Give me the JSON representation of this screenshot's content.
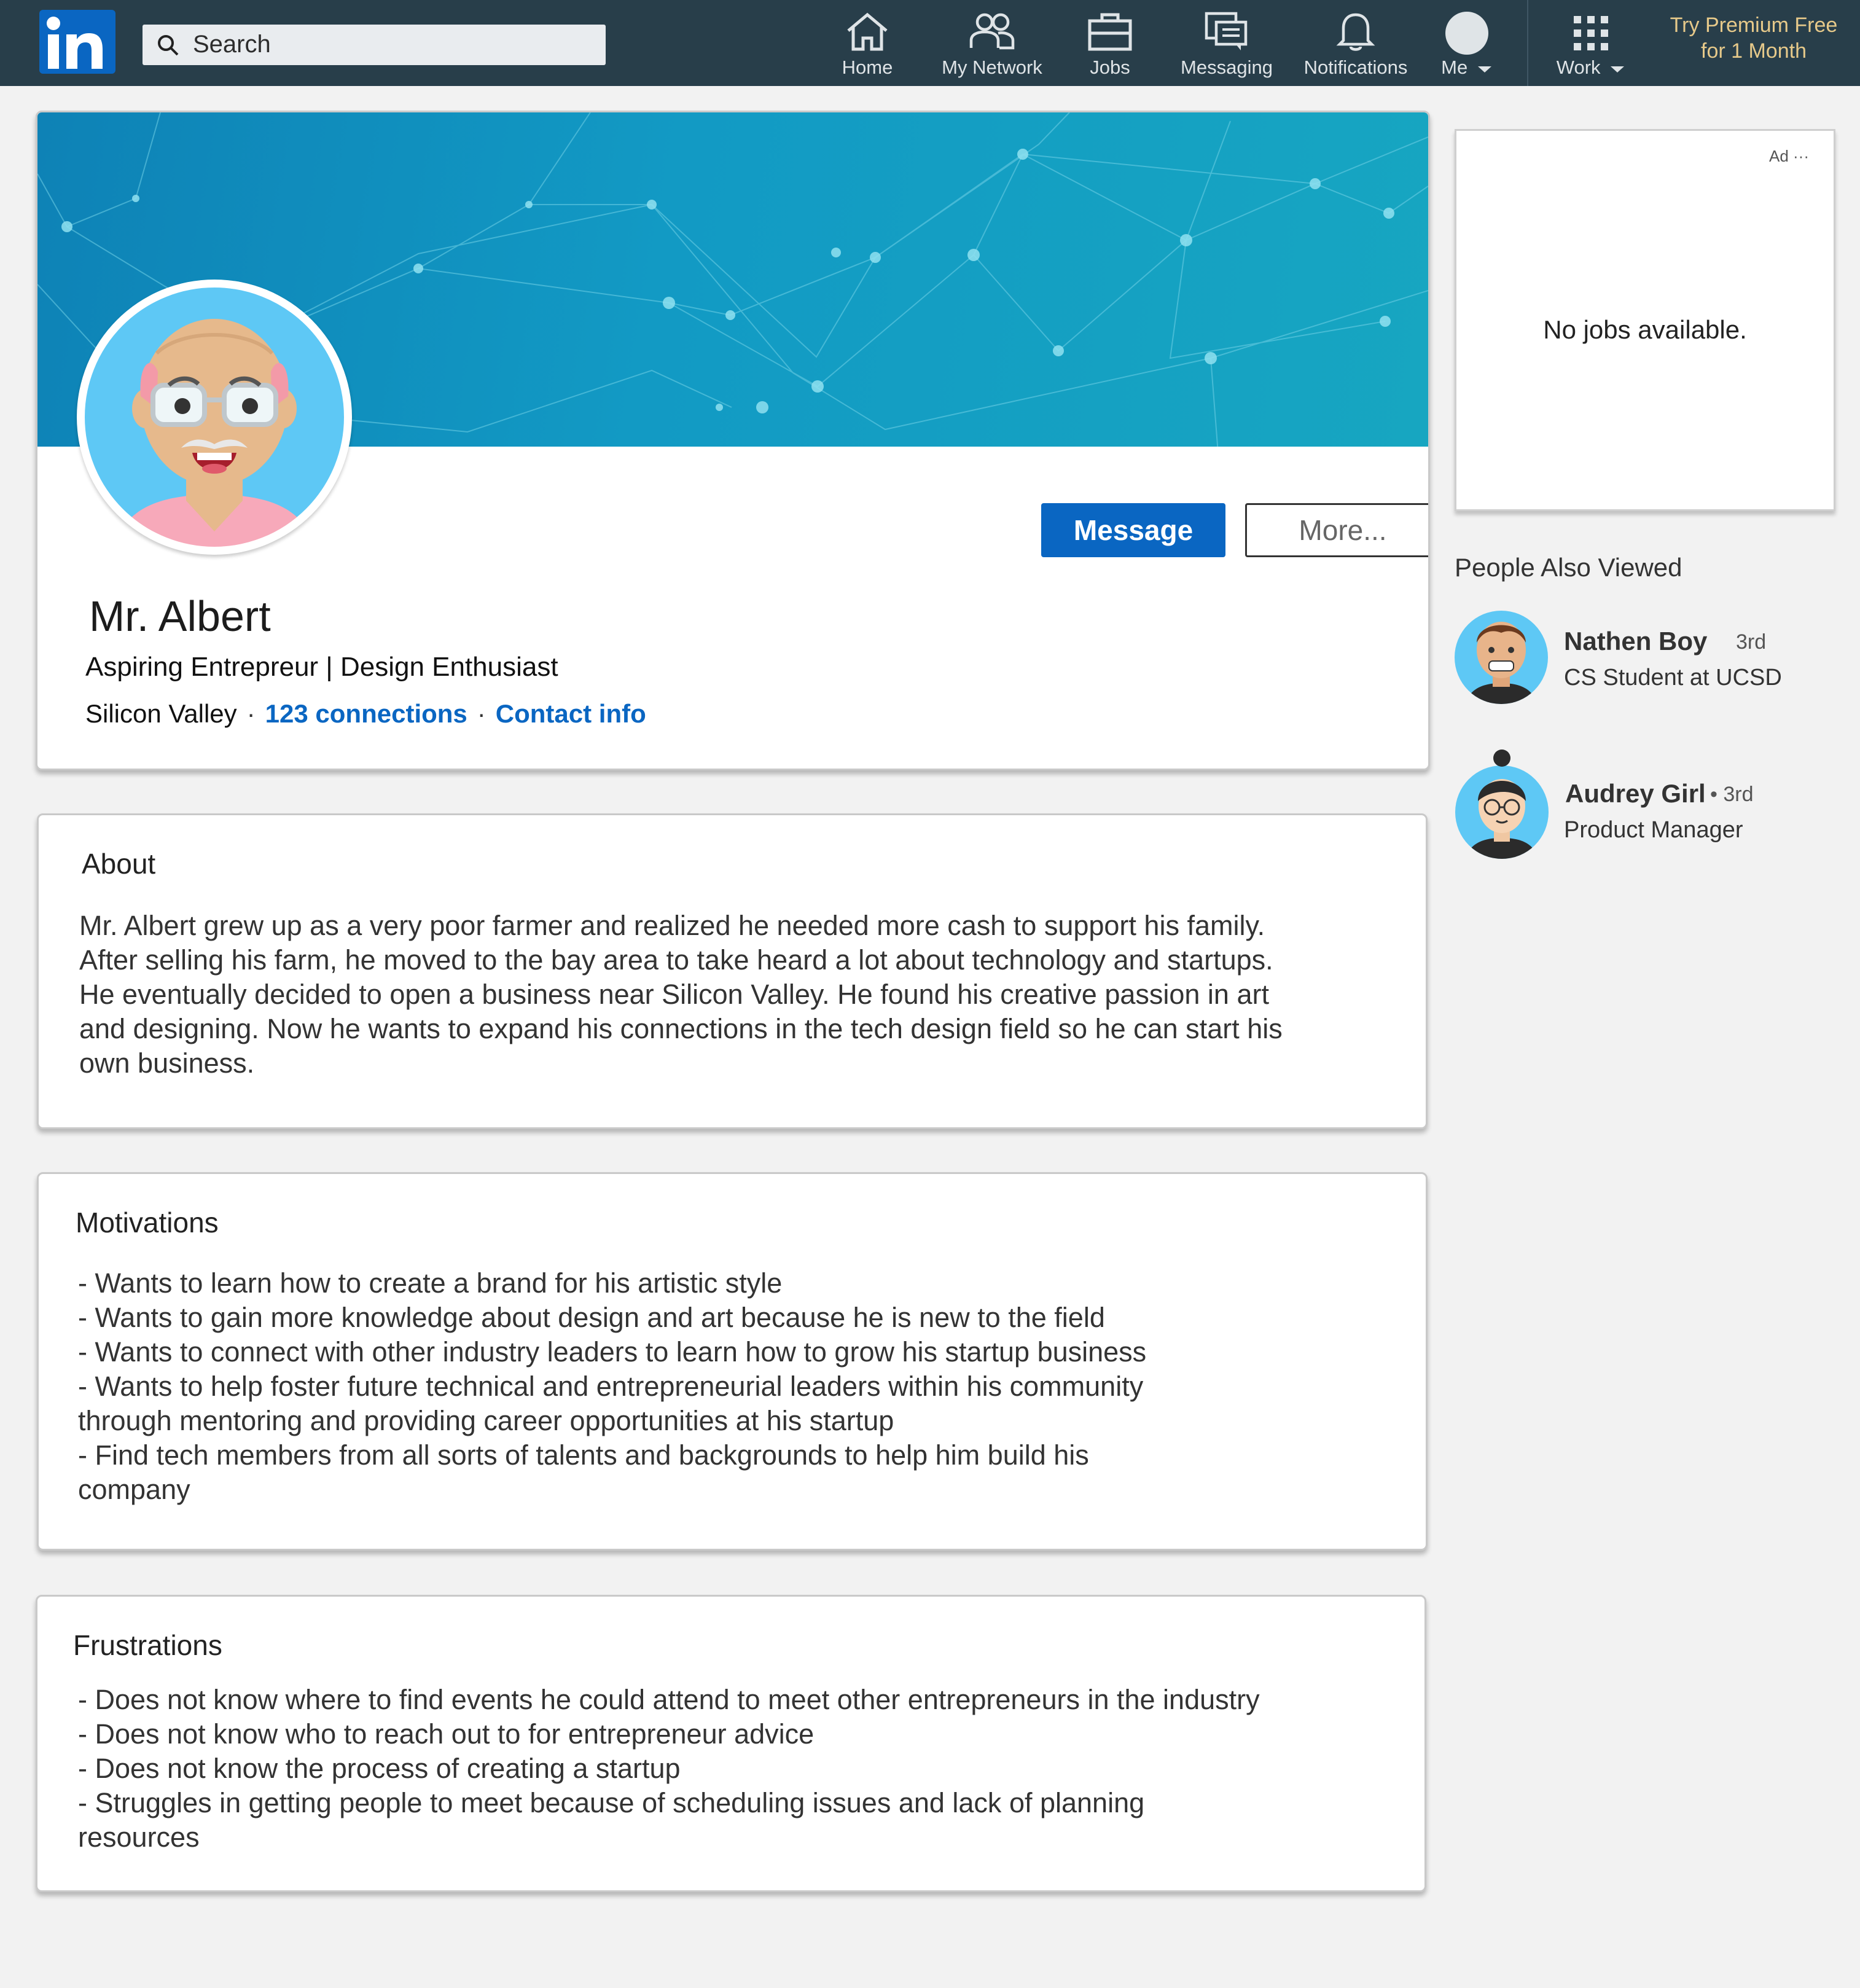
{
  "nav": {
    "search_placeholder": "Search",
    "items": [
      {
        "label": "Home",
        "icon": "home-icon"
      },
      {
        "label": "My Network",
        "icon": "network-icon"
      },
      {
        "label": "Jobs",
        "icon": "briefcase-icon"
      },
      {
        "label": "Messaging",
        "icon": "messaging-icon"
      },
      {
        "label": "Notifications",
        "icon": "bell-icon"
      },
      {
        "label": "Me",
        "icon": "avatar-icon"
      },
      {
        "label": "Work",
        "icon": "grid-icon"
      }
    ],
    "premium": [
      "Try Premium Free",
      "for 1 Month"
    ]
  },
  "profile": {
    "name": "Mr. Albert",
    "headline": "Aspiring Entrepreur | Design Enthusiast",
    "location": "Silicon Valley",
    "connections": "123 connections",
    "contact": "Contact info",
    "message_label": "Message",
    "more_label": "More..."
  },
  "about": {
    "title": "About",
    "body": "Mr. Albert grew up as a very poor farmer and realized he needed more cash to support his family.\nAfter selling his farm, he moved to the bay area to take heard a lot about technology and startups.\nHe eventually decided to open a business near Silicon Valley. He found his creative passion in art\nand designing. Now he wants to expand his connections in the tech design field so he can start his\nown business."
  },
  "motivations": {
    "title": "Motivations",
    "body": "- Wants to learn how to create a brand for his artistic style\n- Wants to gain more knowledge about design and art because he is new to the field\n- Wants to connect with other industry leaders to learn how to grow his startup business\n- Wants to help foster future technical and entrepreneurial leaders within his community\nthrough mentoring and providing career opportunities at his startup\n-  Find tech members from all sorts of talents and backgrounds to help him build his\ncompany"
  },
  "frustrations": {
    "title": "Frustrations",
    "body": "- Does not know where to find events he could attend to meet other entrepreneurs in the industry\n- Does not know who to reach out to for entrepreneur advice\n- Does not know the process of creating a startup\n- Struggles in getting people to meet because of scheduling issues and lack of planning\nresources"
  },
  "ad": {
    "tag": "Ad ···",
    "text": "No jobs available."
  },
  "people_also_viewed": {
    "title": "People Also Viewed",
    "people": [
      {
        "name": "Nathen Boy",
        "degree": "3rd",
        "role": "CS Student at UCSD"
      },
      {
        "name": "Audrey Girl",
        "degree": "• 3rd",
        "role": "Product Manager"
      }
    ]
  },
  "colors": {
    "nav_bg": "#283e4a",
    "brand_blue": "#0a66c2",
    "premium_gold": "#e6c98a",
    "banner": "#129ac4"
  }
}
